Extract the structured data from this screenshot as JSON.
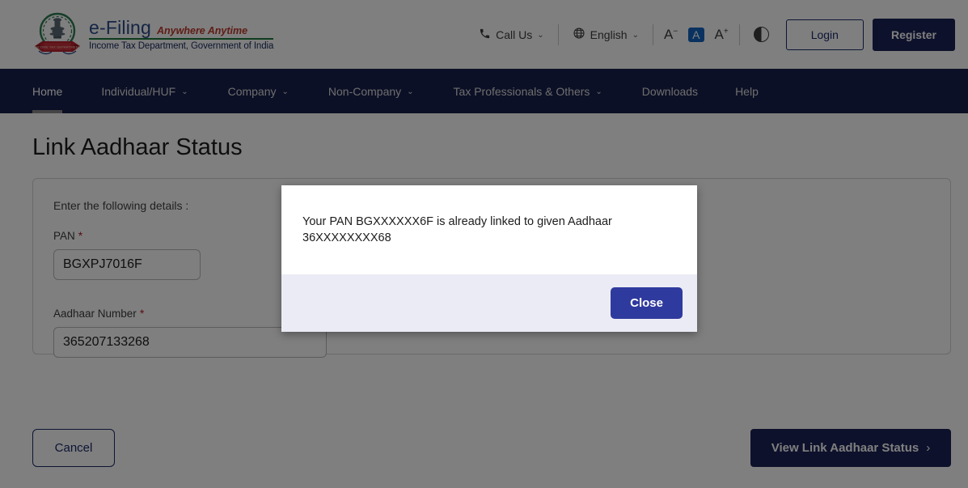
{
  "header": {
    "brand": {
      "emblem_icon": "india-emblem-icon",
      "title": "e-Filing",
      "tagline": "Anywhere Anytime",
      "department": "Income Tax Department, Government of India"
    },
    "tools": {
      "call_us": {
        "icon": "phone-icon",
        "label": "Call Us",
        "caret": "⌄"
      },
      "language": {
        "icon": "globe-icon",
        "label": "English",
        "caret": "⌄"
      },
      "font_decrease": "A",
      "font_decrease_sup": "−",
      "font_normal": "A",
      "font_increase": "A",
      "font_increase_sup": "+",
      "contrast_icon": "contrast-icon",
      "login_label": "Login",
      "register_label": "Register"
    }
  },
  "nav": {
    "items": [
      {
        "label": "Home",
        "has_caret": false,
        "active": true
      },
      {
        "label": "Individual/HUF",
        "has_caret": true,
        "active": false
      },
      {
        "label": "Company",
        "has_caret": true,
        "active": false
      },
      {
        "label": "Non-Company",
        "has_caret": true,
        "active": false
      },
      {
        "label": "Tax Professionals & Others",
        "has_caret": true,
        "active": false
      },
      {
        "label": "Downloads",
        "has_caret": false,
        "active": false
      },
      {
        "label": "Help",
        "has_caret": false,
        "active": false
      }
    ],
    "caret": "⌄"
  },
  "main": {
    "page_title": "Link Aadhaar Status",
    "card": {
      "hint": "Enter the following details :",
      "fields": [
        {
          "label": "PAN",
          "required_mark": "*",
          "value": "BGXPJ7016F",
          "placeholder": "Enter your PAN"
        },
        {
          "label": "Aadhaar Number",
          "required_mark": "*",
          "value": "365207133268",
          "placeholder": "Enter your Aadhaar Number"
        }
      ]
    },
    "cancel_label": "Cancel",
    "submit_label": "View Link Aadhaar Status",
    "submit_chevron": "›"
  },
  "modal": {
    "message": "Your PAN BGXXXXXX6F is already linked to given Aadhaar 36XXXXXXXX68",
    "close_label": "Close"
  },
  "colors": {
    "nav_bg": "#18214d",
    "brand_blue": "#2a4a8b",
    "brand_red": "#c0392b",
    "brand_green": "#1f7a3f",
    "primary_navy": "#1a2257",
    "modal_button_blue": "#2f3a9e",
    "modal_footer_bg": "#ebebf5",
    "required_red": "#b5192b",
    "accessibility_active": "#1565c0"
  }
}
